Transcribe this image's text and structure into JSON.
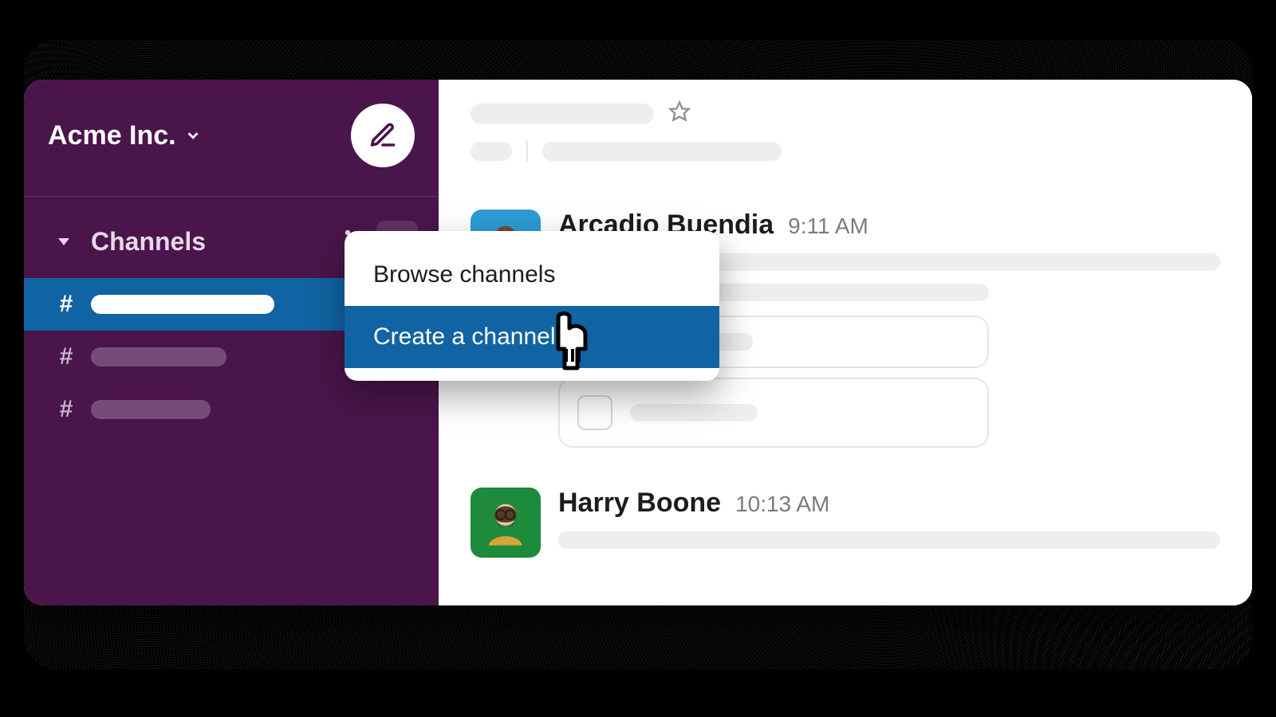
{
  "workspace": {
    "name": "Acme Inc."
  },
  "sidebar": {
    "section_label": "Channels",
    "channels_count": 3,
    "active_index": 0
  },
  "menu": {
    "items": [
      {
        "label": "Browse channels",
        "hover": false
      },
      {
        "label": "Create a channel",
        "hover": true
      }
    ]
  },
  "messages": [
    {
      "author": "Arcadio Buendia",
      "time": "9:11 AM"
    },
    {
      "author": "Harry Boone",
      "time": "10:13 AM"
    }
  ],
  "colors": {
    "sidebar": "#4a154b",
    "accent": "#1164a3"
  }
}
